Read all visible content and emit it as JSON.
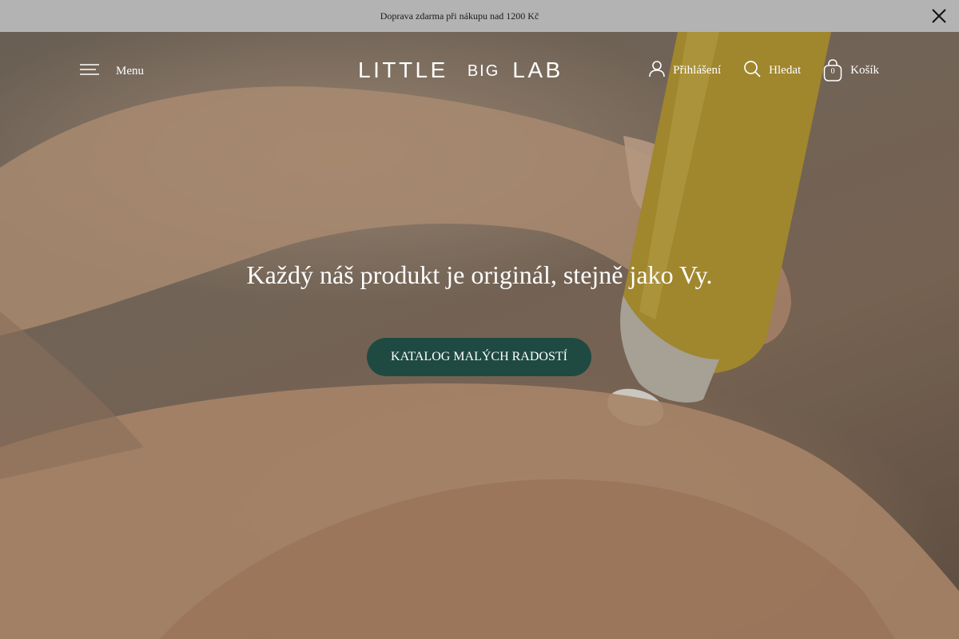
{
  "announcement": {
    "text": "Doprava zdarma při nákupu nad 1200 Kč",
    "close_icon": "close-icon"
  },
  "header": {
    "menu_label": "Menu",
    "menu_icon": "hamburger-icon",
    "logo": {
      "part1": "LITTLE",
      "part2": "BIG",
      "part3": "LAB"
    },
    "login_label": "Přihlášení",
    "login_icon": "user-icon",
    "search_label": "Hledat",
    "search_icon": "search-icon",
    "cart_label": "Košík",
    "cart_icon": "shopping-bag-icon",
    "cart_count": "0"
  },
  "hero": {
    "headline": "Každý náš produkt je originál, stejně jako Vy.",
    "cta_label": "KATALOG MALÝCH RADOSTÍ",
    "image_description_icon": "hero-photo"
  },
  "colors": {
    "announcement_bg": "#b3b3b3",
    "cta_bg": "#1e4a41",
    "text_light": "#ffffff"
  }
}
